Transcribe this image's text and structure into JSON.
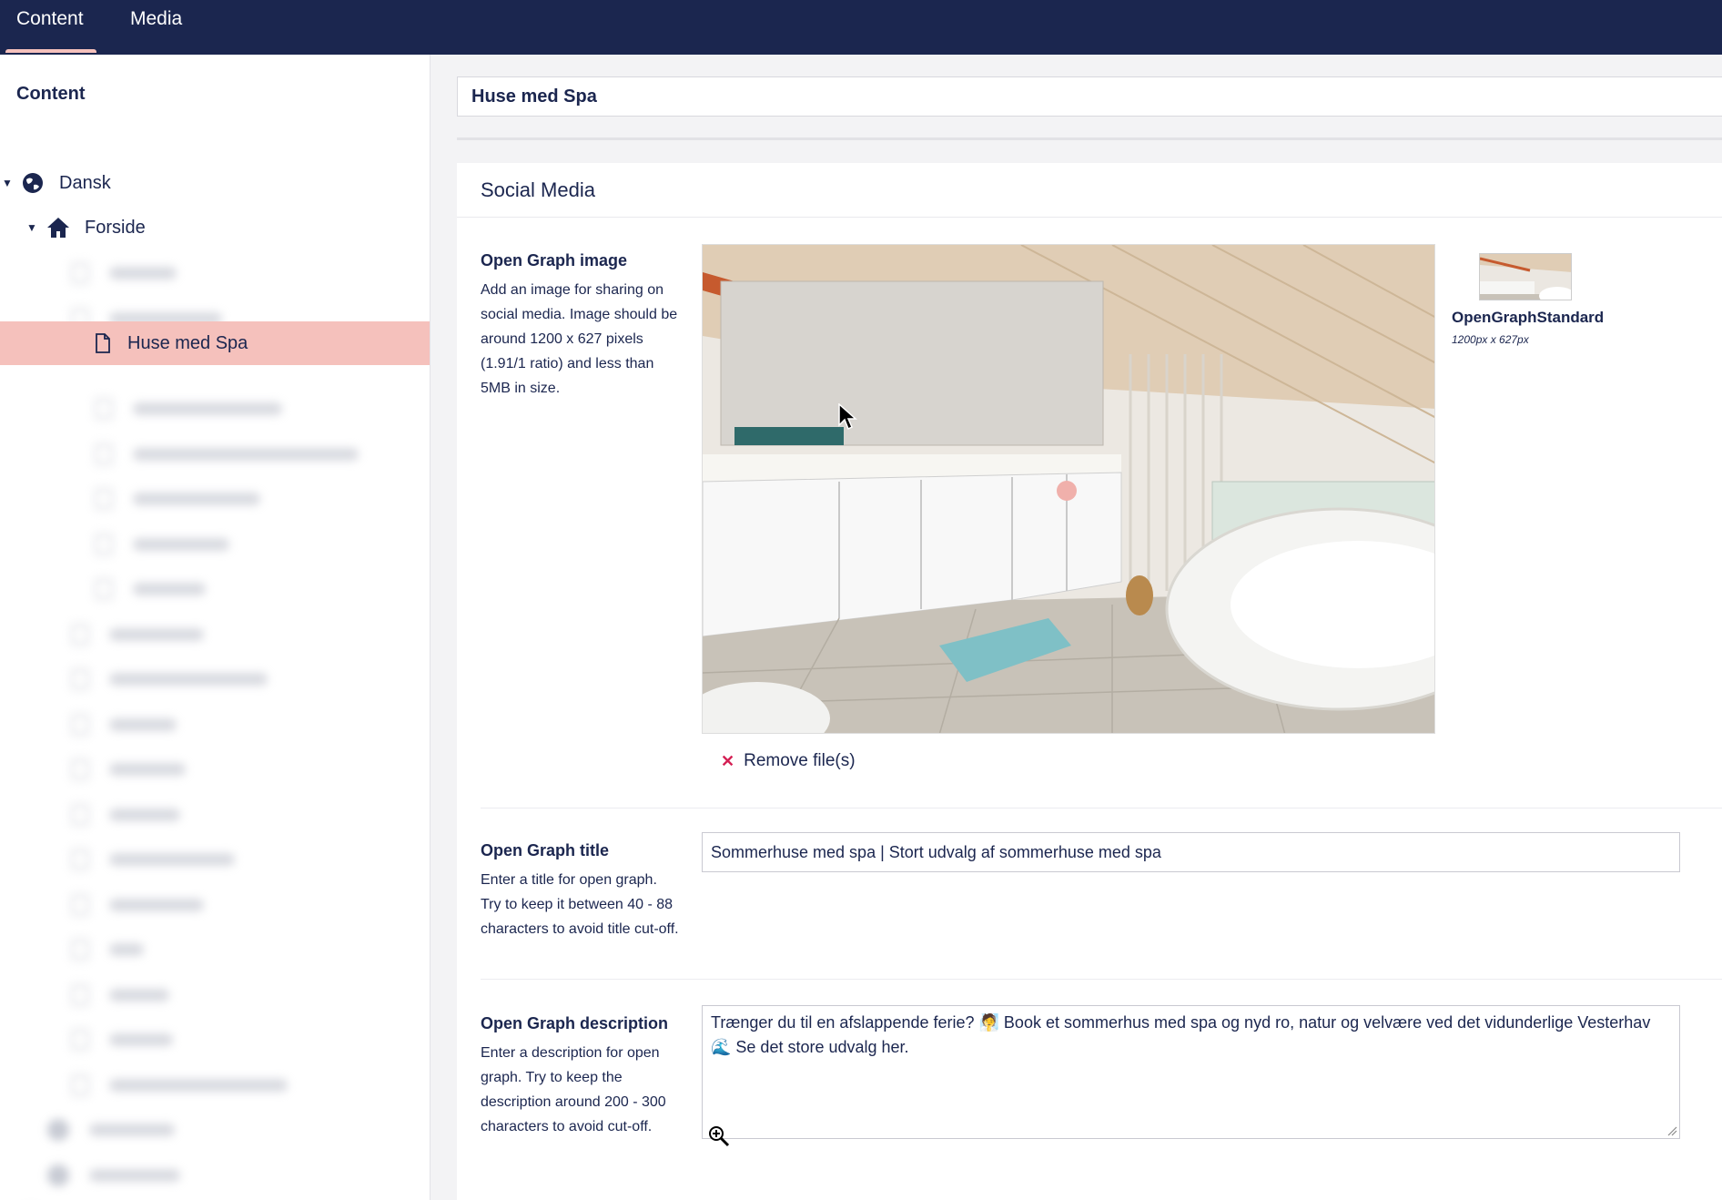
{
  "topbar": {
    "tabs": [
      {
        "label": "Content",
        "active": true
      },
      {
        "label": "Media",
        "active": false
      }
    ]
  },
  "sidebar": {
    "title": "Content",
    "tree": {
      "root_label": "Dansk",
      "root_icon": "globe-icon",
      "home_label": "Forside",
      "home_icon": "home-icon",
      "selected_label": "Huse med Spa",
      "selected_icon": "document-icon"
    }
  },
  "editor": {
    "node_name": "Huse med Spa",
    "group_title": "Social Media",
    "og_image": {
      "label": "Open Graph image",
      "description": "Add an image for sharing on social media. Image should be around 1200 x 627 pixels (1.91/1 ratio) and less than 5MB in size.",
      "crop_name": "OpenGraphStandard",
      "crop_size": "1200px x 627px",
      "remove_label": "Remove file(s)"
    },
    "og_title": {
      "label": "Open Graph title",
      "description": "Enter a title for open graph. Try to keep it between 40 - 88 characters to avoid title cut-off.",
      "value": "Sommerhuse med spa | Stort udvalg af sommerhuse med spa"
    },
    "og_description": {
      "label": "Open Graph description",
      "description": "Enter a description for open graph. Try to keep the description around 200 - 300 characters to avoid cut-off.",
      "value": "Trænger du til en afslappende ferie? 🧖 Book et sommerhus med spa og nyd ro, natur og velvære ved det vidunderlige Vesterhav 🌊 Se det store udvalg her."
    }
  },
  "colors": {
    "header_bg": "#1b264f",
    "selected_bg": "#f5c1bc",
    "remove_x": "#d42054"
  }
}
